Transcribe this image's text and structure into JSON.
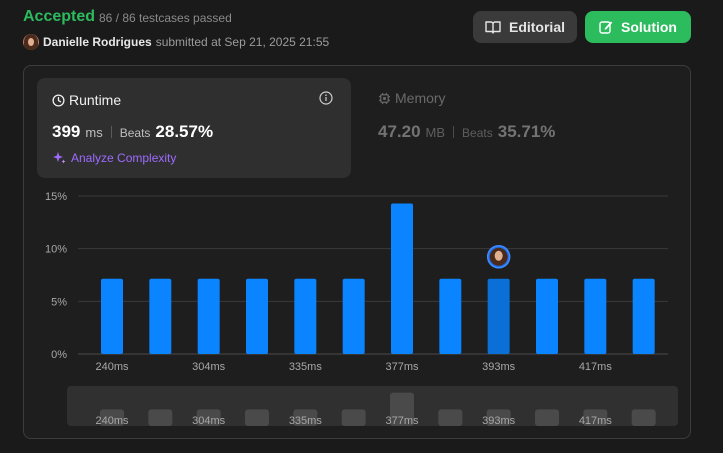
{
  "submission": {
    "status": "Accepted",
    "passed": "86 / 86 testcases passed",
    "username": "Danielle Rodrigues",
    "submitted_text": "submitted at Sep 21, 2025 21:55"
  },
  "buttons": {
    "editorial": "Editorial",
    "solution": "Solution"
  },
  "runtime": {
    "title": "Runtime",
    "value": "399",
    "unit": "ms",
    "beats_label": "Beats",
    "beats_value": "28.57%",
    "analyze_label": "Analyze Complexity"
  },
  "memory": {
    "title": "Memory",
    "value": "47.20",
    "unit": "MB",
    "beats_label": "Beats",
    "beats_value": "35.71%"
  },
  "colors": {
    "accepted": "#2cbb5d",
    "bar": "#0a84ff",
    "bar_selected": "#0a6fd6",
    "analyze": "#9e6bff"
  },
  "icons": [
    "book-icon",
    "edit-icon",
    "clock-icon",
    "info-icon",
    "sparkle-icon",
    "chip-icon"
  ],
  "chart_data": {
    "type": "bar",
    "categories": [
      "240ms",
      "",
      "304ms",
      "",
      "335ms",
      "",
      "377ms",
      "",
      "393ms",
      "",
      "417ms",
      ""
    ],
    "values": [
      7.14,
      7.14,
      7.14,
      7.14,
      7.14,
      7.14,
      14.29,
      7.14,
      7.14,
      7.14,
      7.14,
      7.14
    ],
    "ylim": [
      0,
      15
    ],
    "yticks": [
      "15%",
      "10%",
      "5%",
      "0%"
    ],
    "ytick_values": [
      15,
      10,
      5,
      0
    ],
    "selected_index": 8,
    "grid": true
  },
  "mini_chart": {
    "labels": [
      "240ms",
      "304ms",
      "335ms",
      "377ms",
      "393ms",
      "417ms"
    ],
    "label_indices": [
      0,
      2,
      4,
      6,
      8,
      10
    ]
  }
}
